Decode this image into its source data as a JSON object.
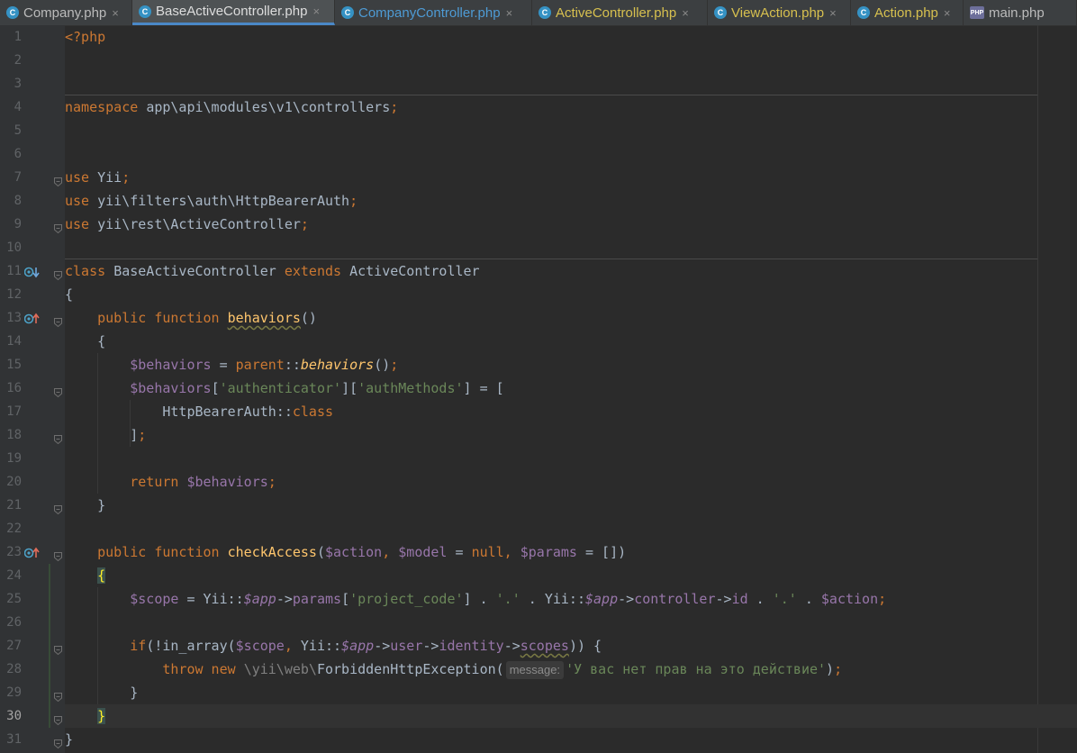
{
  "tabs": [
    {
      "label": "Company.php",
      "icon": "php-class-icon",
      "state": "normal"
    },
    {
      "label": "BaseActiveController.php",
      "icon": "php-class-icon",
      "state": "active"
    },
    {
      "label": "CompanyController.php",
      "icon": "php-class-icon",
      "state": "modified"
    },
    {
      "label": "ActiveController.php",
      "icon": "php-class-icon",
      "state": "changed"
    },
    {
      "label": "ViewAction.php",
      "icon": "php-class-icon",
      "state": "changed"
    },
    {
      "label": "Action.php",
      "icon": "php-class-icon",
      "state": "changed"
    },
    {
      "label": "main.php",
      "icon": "php-file-icon",
      "state": "normal"
    }
  ],
  "tab_close_glyph": "×",
  "current_line": 30,
  "code_lines": [
    {
      "n": 1,
      "parts": [
        [
          "kw",
          "<?php"
        ]
      ]
    },
    {
      "n": 2,
      "parts": []
    },
    {
      "n": 3,
      "parts": []
    },
    {
      "n": 4,
      "parts": [
        [
          "kw",
          "namespace "
        ],
        [
          "cls",
          "app\\api\\modules\\v1\\controllers"
        ],
        [
          "kw",
          ";"
        ]
      ]
    },
    {
      "n": 5,
      "parts": []
    },
    {
      "n": 6,
      "parts": []
    },
    {
      "n": 7,
      "parts": [
        [
          "kw",
          "use "
        ],
        [
          "cls",
          "Yii"
        ],
        [
          "kw",
          ";"
        ]
      ]
    },
    {
      "n": 8,
      "parts": [
        [
          "kw",
          "use "
        ],
        [
          "cls",
          "yii\\filters\\auth\\HttpBearerAuth"
        ],
        [
          "kw",
          ";"
        ]
      ]
    },
    {
      "n": 9,
      "parts": [
        [
          "kw",
          "use "
        ],
        [
          "cls",
          "yii\\rest\\ActiveController"
        ],
        [
          "kw",
          ";"
        ]
      ]
    },
    {
      "n": 10,
      "parts": []
    },
    {
      "n": 11,
      "parts": [
        [
          "kw",
          "class "
        ],
        [
          "cls",
          "BaseActiveController "
        ],
        [
          "kw",
          "extends "
        ],
        [
          "cls",
          "ActiveController"
        ]
      ]
    },
    {
      "n": 12,
      "parts": [
        [
          "cls",
          "{"
        ]
      ]
    },
    {
      "n": 13,
      "parts": [
        [
          "cls",
          "    "
        ],
        [
          "kw",
          "public function "
        ],
        [
          "fn wavy",
          "behaviors"
        ],
        [
          "cls",
          "()"
        ]
      ]
    },
    {
      "n": 14,
      "parts": [
        [
          "cls",
          "    {"
        ]
      ]
    },
    {
      "n": 15,
      "parts": [
        [
          "cls",
          "        "
        ],
        [
          "var",
          "$behaviors"
        ],
        [
          "cls",
          " = "
        ],
        [
          "kw",
          "parent"
        ],
        [
          "cls",
          "::"
        ],
        [
          "fni",
          "behaviors"
        ],
        [
          "cls",
          "()"
        ],
        [
          "kw",
          ";"
        ]
      ]
    },
    {
      "n": 16,
      "parts": [
        [
          "cls",
          "        "
        ],
        [
          "var",
          "$behaviors"
        ],
        [
          "cls",
          "["
        ],
        [
          "str",
          "'authenticator'"
        ],
        [
          "cls",
          "]["
        ],
        [
          "str",
          "'authMethods'"
        ],
        [
          "cls",
          "] = ["
        ]
      ]
    },
    {
      "n": 17,
      "parts": [
        [
          "cls",
          "            HttpBearerAuth::"
        ],
        [
          "kw",
          "class"
        ]
      ]
    },
    {
      "n": 18,
      "parts": [
        [
          "cls",
          "        ]"
        ],
        [
          "kw",
          ";"
        ]
      ]
    },
    {
      "n": 19,
      "parts": []
    },
    {
      "n": 20,
      "parts": [
        [
          "cls",
          "        "
        ],
        [
          "kw",
          "return "
        ],
        [
          "var",
          "$behaviors"
        ],
        [
          "kw",
          ";"
        ]
      ]
    },
    {
      "n": 21,
      "parts": [
        [
          "cls",
          "    }"
        ]
      ]
    },
    {
      "n": 22,
      "parts": []
    },
    {
      "n": 23,
      "parts": [
        [
          "cls",
          "    "
        ],
        [
          "kw",
          "public function "
        ],
        [
          "fn",
          "checkAccess"
        ],
        [
          "cls",
          "("
        ],
        [
          "var",
          "$action"
        ],
        [
          "kw",
          ", "
        ],
        [
          "var",
          "$model"
        ],
        [
          "cls",
          " = "
        ],
        [
          "kw",
          "null, "
        ],
        [
          "var",
          "$params"
        ],
        [
          "cls",
          " = [])"
        ]
      ]
    },
    {
      "n": 24,
      "parts": [
        [
          "cls",
          "    "
        ],
        [
          "brace-hl",
          "{"
        ]
      ]
    },
    {
      "n": 25,
      "parts": [
        [
          "cls",
          "        "
        ],
        [
          "var",
          "$scope"
        ],
        [
          "cls",
          " = Yii::"
        ],
        [
          "ivar",
          "$app"
        ],
        [
          "cls",
          "->"
        ],
        [
          "var",
          "params"
        ],
        [
          "cls",
          "["
        ],
        [
          "str",
          "'project_code'"
        ],
        [
          "cls",
          "] . "
        ],
        [
          "str",
          "'.'"
        ],
        [
          "cls",
          " . Yii::"
        ],
        [
          "ivar",
          "$app"
        ],
        [
          "cls",
          "->"
        ],
        [
          "var",
          "controller"
        ],
        [
          "cls",
          "->"
        ],
        [
          "var",
          "id"
        ],
        [
          "cls",
          " . "
        ],
        [
          "str",
          "'.'"
        ],
        [
          "cls",
          " . "
        ],
        [
          "var",
          "$action"
        ],
        [
          "kw",
          ";"
        ]
      ]
    },
    {
      "n": 26,
      "parts": []
    },
    {
      "n": 27,
      "parts": [
        [
          "cls",
          "        "
        ],
        [
          "kw",
          "if"
        ],
        [
          "cls",
          "(!in_array("
        ],
        [
          "var",
          "$scope"
        ],
        [
          "kw",
          ", "
        ],
        [
          "cls",
          "Yii::"
        ],
        [
          "ivar",
          "$app"
        ],
        [
          "cls",
          "->"
        ],
        [
          "var",
          "user"
        ],
        [
          "cls",
          "->"
        ],
        [
          "var",
          "identity"
        ],
        [
          "cls",
          "->"
        ],
        [
          "var wavy",
          "scopes"
        ],
        [
          "cls",
          ")) {"
        ]
      ]
    },
    {
      "n": 28,
      "parts": [
        [
          "cls",
          "            "
        ],
        [
          "kw",
          "throw new "
        ],
        [
          "ns",
          "\\yii\\web\\"
        ],
        [
          "cls",
          "ForbiddenHttpException("
        ],
        [
          "hint",
          "message:"
        ],
        [
          "str",
          "'У вас нет прав на это действие'"
        ],
        [
          "cls",
          ")"
        ],
        [
          "kw",
          ";"
        ]
      ]
    },
    {
      "n": 29,
      "parts": [
        [
          "cls",
          "        }"
        ]
      ]
    },
    {
      "n": 30,
      "parts": [
        [
          "cls",
          "    "
        ],
        [
          "brace-hl",
          "}"
        ]
      ]
    },
    {
      "n": 31,
      "parts": [
        [
          "cls",
          "}"
        ]
      ]
    }
  ],
  "gutter_icons": {
    "11": "override-down-icon",
    "13": "implements-up-icon",
    "23": "implements-up-icon"
  },
  "fold_lines": [
    7,
    9,
    11,
    13,
    16,
    18,
    21,
    23,
    27,
    29,
    30,
    31
  ],
  "separator_after": [
    3,
    10
  ],
  "changed_lines": [
    24,
    25,
    26,
    27,
    28,
    29,
    30
  ]
}
